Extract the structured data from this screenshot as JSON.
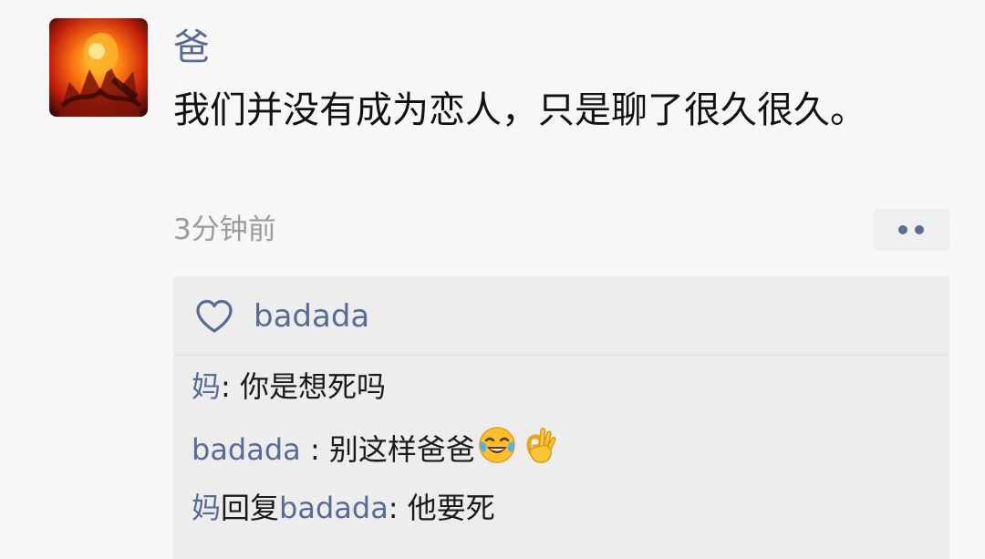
{
  "post": {
    "author": "爸",
    "content": "我们并没有成为恋人，只是聊了很久很久。",
    "time": "3分钟前",
    "avatar_icon": "fire-warrior-avatar-icon",
    "more_icon": "more-dots-icon"
  },
  "likes": {
    "icon": "heart-outline-icon",
    "names": "badada"
  },
  "comments": [
    {
      "author": "妈",
      "separator": ": ",
      "text": "你是想死吗"
    },
    {
      "author": "badada",
      "separator": " : ",
      "text": "别这样爸爸",
      "emojis": [
        "face-with-tears-of-joy-icon",
        "ok-hand-icon"
      ]
    },
    {
      "author": "妈",
      "reply_word": "回复",
      "reply_to": "badada",
      "separator": ": ",
      "text": "他要死"
    }
  ],
  "colors": {
    "nickname": "#576b95",
    "text": "#111111",
    "time": "#9b9b9b",
    "comment_bg": "#ededed",
    "page_bg": "#f7f7f7"
  }
}
